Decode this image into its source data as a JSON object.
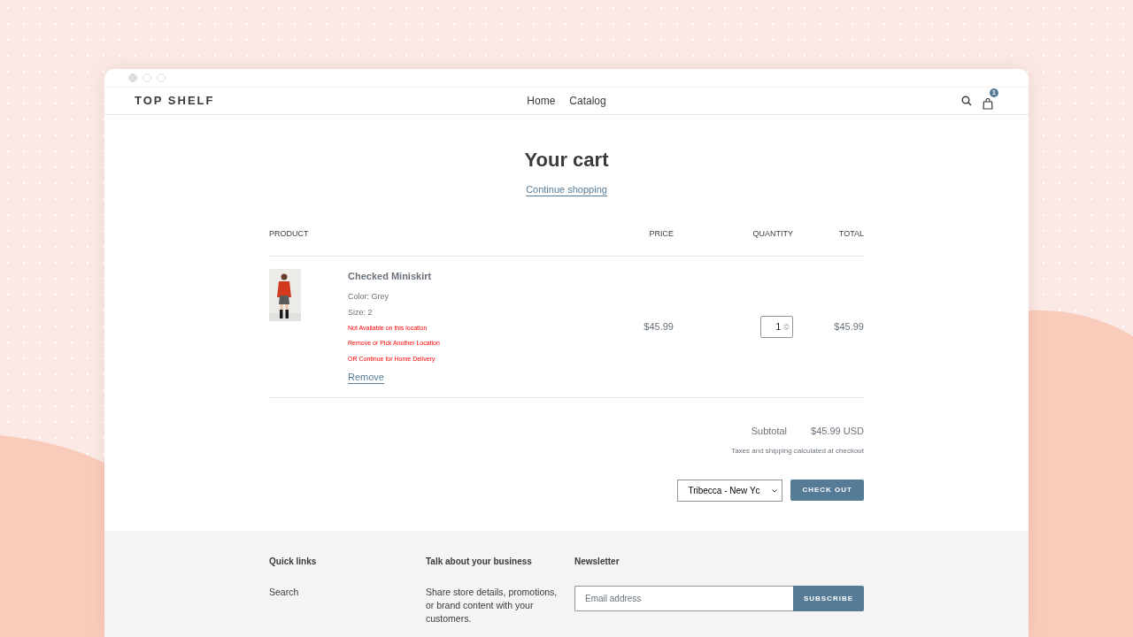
{
  "store": {
    "name": "TOP SHELF",
    "nav": [
      {
        "label": "Home"
      },
      {
        "label": "Catalog"
      }
    ],
    "cart_count": "1"
  },
  "page": {
    "title": "Your cart",
    "continue_link": "Continue shopping"
  },
  "table": {
    "columns": [
      "PRODUCT",
      "PRICE",
      "QUANTITY",
      "TOTAL"
    ],
    "rows": [
      {
        "name": "Checked Miniskirt",
        "options": [
          "Color: Grey",
          "Size: 2"
        ],
        "warnings": [
          "Not Available on this location",
          "Remove or Pick Another Location",
          "OR Continue for Home Delivery"
        ],
        "remove": "Remove",
        "price": "$45.99",
        "quantity": "1",
        "total": "$45.99"
      }
    ]
  },
  "summary": {
    "subtotal_label": "Subtotal",
    "subtotal": "$45.99 USD",
    "note": "Taxes and shipping calculated at checkout",
    "location": "Tribecca - New Yc",
    "checkout": "CHECK OUT"
  },
  "footer": {
    "columns": [
      {
        "kind": "links",
        "title": "Quick links",
        "links": [
          "Search"
        ]
      },
      {
        "kind": "text",
        "title": "Talk about your business",
        "text": "Share store details, promotions, or brand content with your customers."
      },
      {
        "kind": "newsletter",
        "title": "Newsletter",
        "placeholder": "Email address",
        "button": "SUBSCRIBE"
      }
    ]
  }
}
